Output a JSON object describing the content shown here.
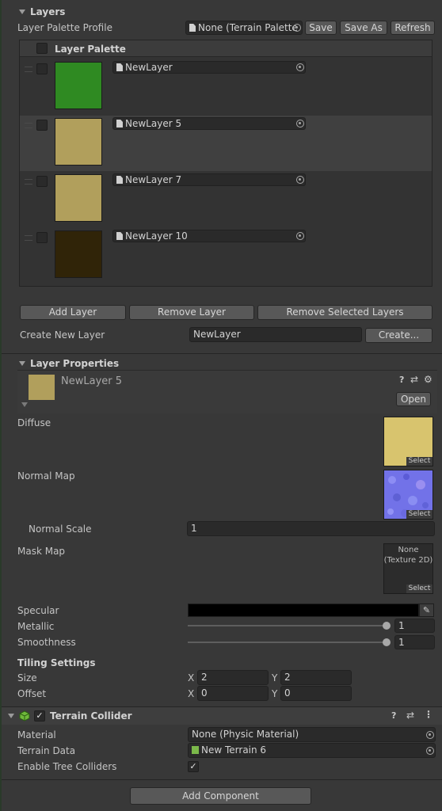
{
  "layers_section": {
    "title": "Layers",
    "palette_profile_label": "Layer Palette Profile",
    "palette_profile_value": "None (Terrain Palette",
    "save": "Save",
    "save_as": "Save As",
    "refresh": "Refresh",
    "palette_header": "Layer Palette",
    "layers": [
      {
        "name": "NewLayer",
        "color": "#2f8a22"
      },
      {
        "name": "NewLayer 5",
        "color": "#b19f5c"
      },
      {
        "name": "NewLayer 7",
        "color": "#b19f5c"
      },
      {
        "name": "NewLayer 10",
        "color": "#302408"
      }
    ],
    "add_layer": "Add Layer",
    "remove_layer": "Remove Layer",
    "remove_selected": "Remove Selected Layers",
    "create_new_label": "Create New Layer",
    "create_new_value": "NewLayer",
    "create_button": "Create..."
  },
  "layer_properties": {
    "title": "Layer Properties",
    "layer_name": "NewLayer 5",
    "thumb_color": "#b19f5c",
    "open": "Open",
    "diffuse_label": "Diffuse",
    "diffuse_color": "#d8c46e",
    "select": "Select",
    "normal_label": "Normal Map",
    "normal_scale_label": "Normal Scale",
    "normal_scale_value": "1",
    "mask_label": "Mask Map",
    "mask_none_line1": "None",
    "mask_none_line2": "(Texture 2D)",
    "specular_label": "Specular",
    "specular_color": "#000000",
    "metallic_label": "Metallic",
    "metallic_value": "1",
    "smoothness_label": "Smoothness",
    "smoothness_value": "1",
    "tiling_header": "Tiling Settings",
    "size_label": "Size",
    "size_x": "2",
    "size_y": "2",
    "offset_label": "Offset",
    "offset_x": "0",
    "offset_y": "0",
    "x": "X",
    "y": "Y"
  },
  "terrain_collider": {
    "title": "Terrain Collider",
    "material_label": "Material",
    "material_value": "None (Physic Material)",
    "terrain_data_label": "Terrain Data",
    "terrain_data_value": "New Terrain 6",
    "tree_colliders_label": "Enable Tree Colliders"
  },
  "add_component": "Add Component"
}
